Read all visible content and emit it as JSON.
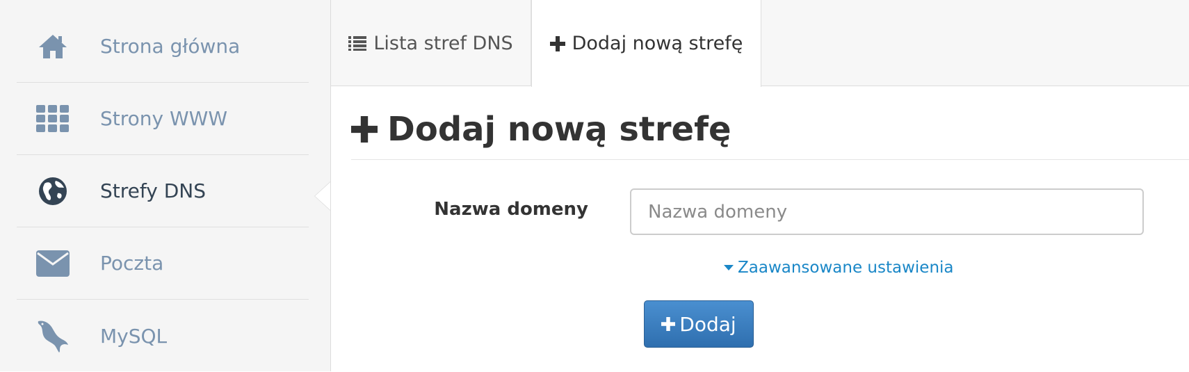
{
  "sidebar": {
    "items": [
      {
        "label": "Strona główna",
        "icon": "home-icon"
      },
      {
        "label": "Strony WWW",
        "icon": "grid-icon"
      },
      {
        "label": "Strefy DNS",
        "icon": "globe-icon",
        "active": true
      },
      {
        "label": "Poczta",
        "icon": "envelope-icon"
      },
      {
        "label": "MySQL",
        "icon": "dolphin-icon"
      }
    ]
  },
  "tabs": [
    {
      "label": "Lista stref DNS",
      "icon": "list-icon"
    },
    {
      "label": "Dodaj nową strefę",
      "icon": "plus-icon",
      "active": true
    }
  ],
  "main": {
    "title": "Dodaj nową strefę",
    "form": {
      "domain_label": "Nazwa domeny",
      "domain_placeholder": "Nazwa domeny",
      "domain_value": "",
      "advanced_link": "Zaawansowane ustawienia",
      "submit_label": "Dodaj"
    }
  },
  "colors": {
    "sidebar_text": "#7a93ae",
    "sidebar_active_text": "#344454",
    "link": "#1a87c7",
    "primary_button": "#2f6faf"
  }
}
